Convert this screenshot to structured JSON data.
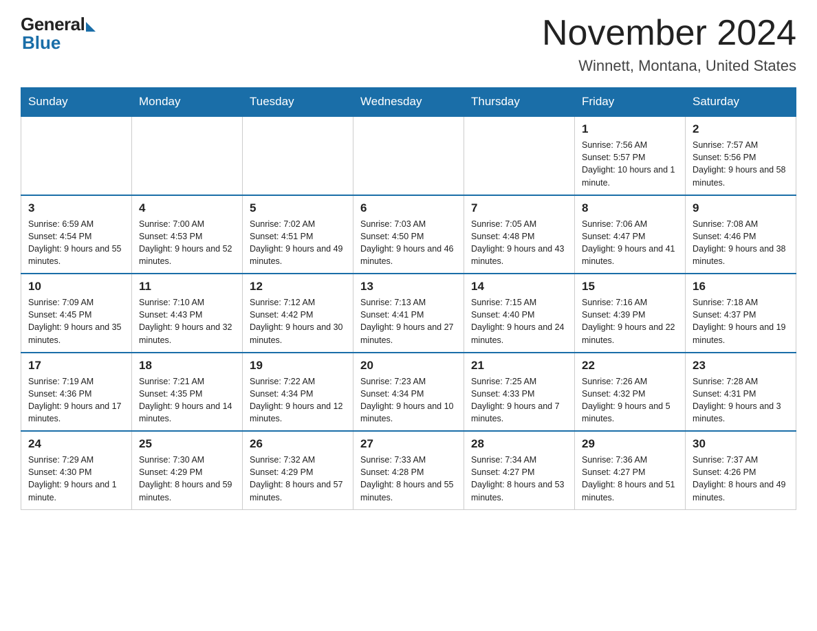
{
  "logo": {
    "text_general": "General",
    "text_blue": "Blue"
  },
  "title": "November 2024",
  "subtitle": "Winnett, Montana, United States",
  "days_of_week": [
    "Sunday",
    "Monday",
    "Tuesday",
    "Wednesday",
    "Thursday",
    "Friday",
    "Saturday"
  ],
  "weeks": [
    [
      {
        "day": "",
        "info": "",
        "empty": true
      },
      {
        "day": "",
        "info": "",
        "empty": true
      },
      {
        "day": "",
        "info": "",
        "empty": true
      },
      {
        "day": "",
        "info": "",
        "empty": true
      },
      {
        "day": "",
        "info": "",
        "empty": true
      },
      {
        "day": "1",
        "info": "Sunrise: 7:56 AM\nSunset: 5:57 PM\nDaylight: 10 hours and 1 minute."
      },
      {
        "day": "2",
        "info": "Sunrise: 7:57 AM\nSunset: 5:56 PM\nDaylight: 9 hours and 58 minutes."
      }
    ],
    [
      {
        "day": "3",
        "info": "Sunrise: 6:59 AM\nSunset: 4:54 PM\nDaylight: 9 hours and 55 minutes."
      },
      {
        "day": "4",
        "info": "Sunrise: 7:00 AM\nSunset: 4:53 PM\nDaylight: 9 hours and 52 minutes."
      },
      {
        "day": "5",
        "info": "Sunrise: 7:02 AM\nSunset: 4:51 PM\nDaylight: 9 hours and 49 minutes."
      },
      {
        "day": "6",
        "info": "Sunrise: 7:03 AM\nSunset: 4:50 PM\nDaylight: 9 hours and 46 minutes."
      },
      {
        "day": "7",
        "info": "Sunrise: 7:05 AM\nSunset: 4:48 PM\nDaylight: 9 hours and 43 minutes."
      },
      {
        "day": "8",
        "info": "Sunrise: 7:06 AM\nSunset: 4:47 PM\nDaylight: 9 hours and 41 minutes."
      },
      {
        "day": "9",
        "info": "Sunrise: 7:08 AM\nSunset: 4:46 PM\nDaylight: 9 hours and 38 minutes."
      }
    ],
    [
      {
        "day": "10",
        "info": "Sunrise: 7:09 AM\nSunset: 4:45 PM\nDaylight: 9 hours and 35 minutes."
      },
      {
        "day": "11",
        "info": "Sunrise: 7:10 AM\nSunset: 4:43 PM\nDaylight: 9 hours and 32 minutes."
      },
      {
        "day": "12",
        "info": "Sunrise: 7:12 AM\nSunset: 4:42 PM\nDaylight: 9 hours and 30 minutes."
      },
      {
        "day": "13",
        "info": "Sunrise: 7:13 AM\nSunset: 4:41 PM\nDaylight: 9 hours and 27 minutes."
      },
      {
        "day": "14",
        "info": "Sunrise: 7:15 AM\nSunset: 4:40 PM\nDaylight: 9 hours and 24 minutes."
      },
      {
        "day": "15",
        "info": "Sunrise: 7:16 AM\nSunset: 4:39 PM\nDaylight: 9 hours and 22 minutes."
      },
      {
        "day": "16",
        "info": "Sunrise: 7:18 AM\nSunset: 4:37 PM\nDaylight: 9 hours and 19 minutes."
      }
    ],
    [
      {
        "day": "17",
        "info": "Sunrise: 7:19 AM\nSunset: 4:36 PM\nDaylight: 9 hours and 17 minutes."
      },
      {
        "day": "18",
        "info": "Sunrise: 7:21 AM\nSunset: 4:35 PM\nDaylight: 9 hours and 14 minutes."
      },
      {
        "day": "19",
        "info": "Sunrise: 7:22 AM\nSunset: 4:34 PM\nDaylight: 9 hours and 12 minutes."
      },
      {
        "day": "20",
        "info": "Sunrise: 7:23 AM\nSunset: 4:34 PM\nDaylight: 9 hours and 10 minutes."
      },
      {
        "day": "21",
        "info": "Sunrise: 7:25 AM\nSunset: 4:33 PM\nDaylight: 9 hours and 7 minutes."
      },
      {
        "day": "22",
        "info": "Sunrise: 7:26 AM\nSunset: 4:32 PM\nDaylight: 9 hours and 5 minutes."
      },
      {
        "day": "23",
        "info": "Sunrise: 7:28 AM\nSunset: 4:31 PM\nDaylight: 9 hours and 3 minutes."
      }
    ],
    [
      {
        "day": "24",
        "info": "Sunrise: 7:29 AM\nSunset: 4:30 PM\nDaylight: 9 hours and 1 minute."
      },
      {
        "day": "25",
        "info": "Sunrise: 7:30 AM\nSunset: 4:29 PM\nDaylight: 8 hours and 59 minutes."
      },
      {
        "day": "26",
        "info": "Sunrise: 7:32 AM\nSunset: 4:29 PM\nDaylight: 8 hours and 57 minutes."
      },
      {
        "day": "27",
        "info": "Sunrise: 7:33 AM\nSunset: 4:28 PM\nDaylight: 8 hours and 55 minutes."
      },
      {
        "day": "28",
        "info": "Sunrise: 7:34 AM\nSunset: 4:27 PM\nDaylight: 8 hours and 53 minutes."
      },
      {
        "day": "29",
        "info": "Sunrise: 7:36 AM\nSunset: 4:27 PM\nDaylight: 8 hours and 51 minutes."
      },
      {
        "day": "30",
        "info": "Sunrise: 7:37 AM\nSunset: 4:26 PM\nDaylight: 8 hours and 49 minutes."
      }
    ]
  ]
}
